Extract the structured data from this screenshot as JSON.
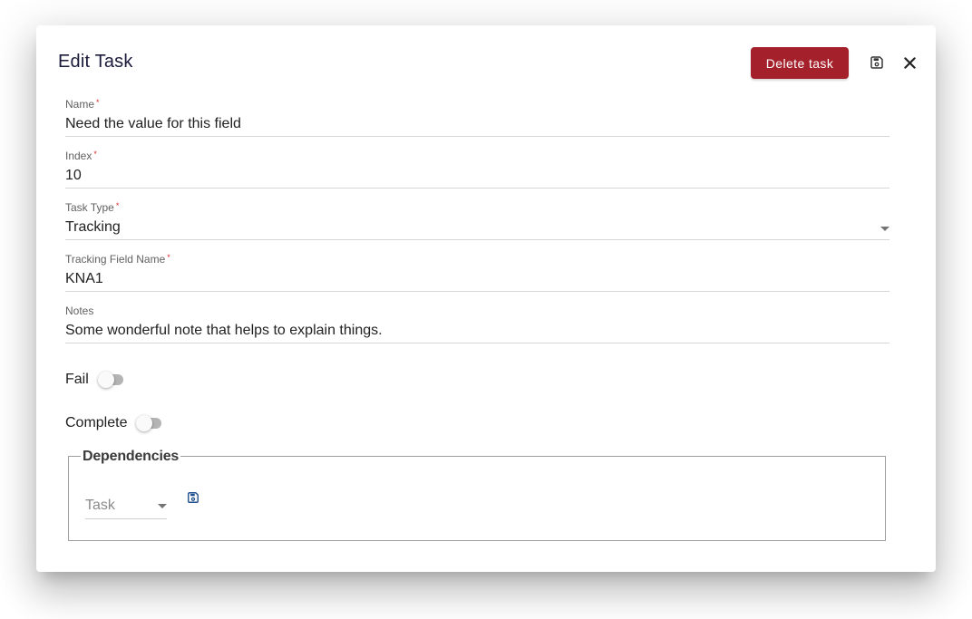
{
  "dialog": {
    "title": "Edit Task",
    "delete_label": "Delete task",
    "save_icon": "save-icon",
    "close_icon": "close-icon"
  },
  "colors": {
    "accent": "#a4212c",
    "required": "#d32f2f",
    "icon_blue": "#1e4f8f"
  },
  "fields": {
    "name": {
      "label": "Name",
      "required": "*",
      "value": "Need the value for this field"
    },
    "index": {
      "label": "Index",
      "required": "*",
      "value": "10"
    },
    "task_type": {
      "label": "Task Type",
      "required": "*",
      "value": "Tracking"
    },
    "tracking_field": {
      "label": "Tracking Field Name",
      "required": "*",
      "value": "KNA1"
    },
    "notes": {
      "label": "Notes",
      "value": "Some wonderful note that helps to explain things."
    }
  },
  "toggles": {
    "fail": {
      "label": "Fail",
      "on": false
    },
    "complete": {
      "label": "Complete",
      "on": false
    }
  },
  "dependencies": {
    "legend": "Dependencies",
    "select_placeholder": "Task",
    "save_icon": "save-icon"
  }
}
